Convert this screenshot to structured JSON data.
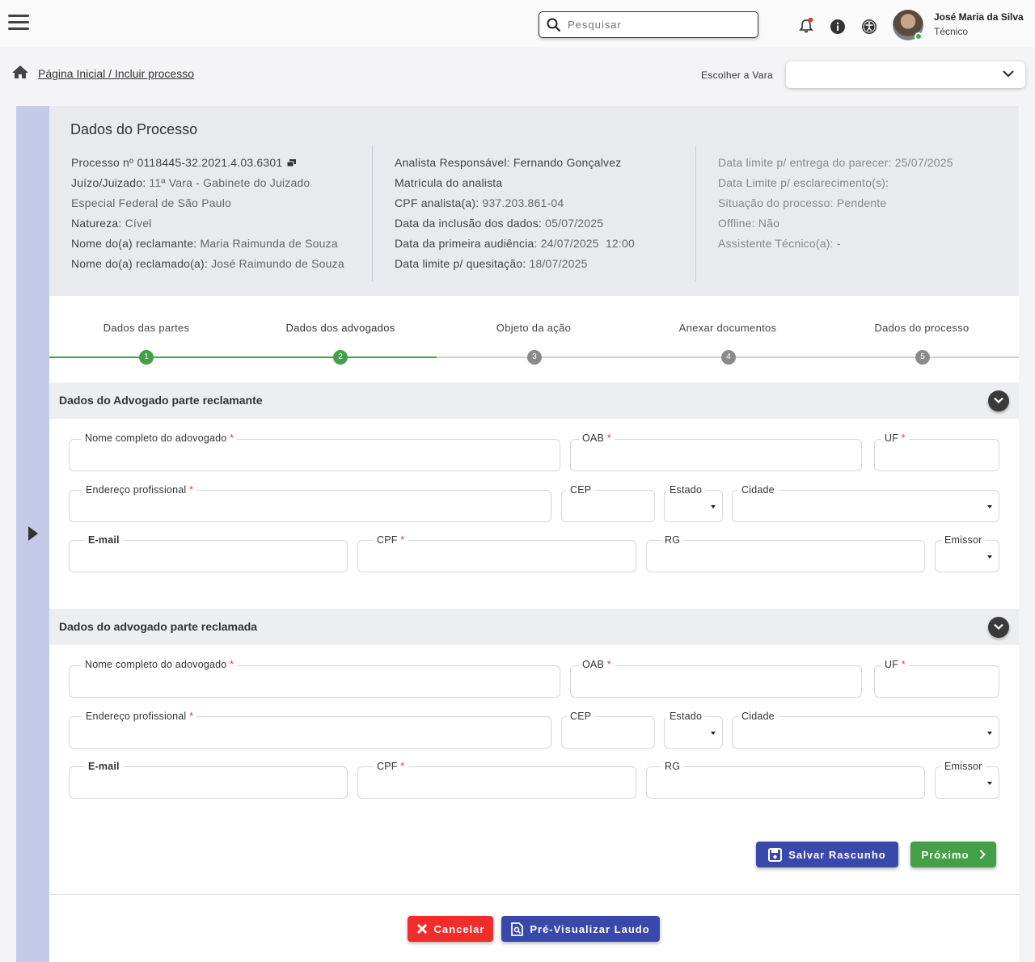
{
  "header": {
    "search_placeholder": "Pesquisar",
    "user_name": "José Maria da Silva",
    "user_role": "Técnico"
  },
  "breadcrumb": "Página Inicial / Incluir processo",
  "vara": {
    "label": "Escolher a Vara",
    "value": ""
  },
  "info": {
    "title": "Dados do Processo",
    "col1": [
      {
        "label": "Processo nº",
        "value": "0118445-32.2021.4.03.6301"
      },
      {
        "label": "Juízo/Juizado:",
        "value": "11ª Vara - Gabinete do Juizado"
      },
      {
        "label": "",
        "value": "Especial Federal de São Paulo"
      },
      {
        "label": "Natureza:",
        "value": "Cível"
      },
      {
        "label": "Nome do(a) reclamante:",
        "value": "Maria Raimunda de Souza"
      },
      {
        "label": "Nome do(a) reclamado(a):",
        "value": "José Raimundo de Souza"
      }
    ],
    "col2": [
      {
        "label": "Analista Responsável:",
        "value": "Fernando Gonçalvez"
      },
      {
        "label": "Matrícula do analista",
        "value": ""
      },
      {
        "label": "CPF analista(a):",
        "value": "937.203.861-04"
      },
      {
        "label": "Data da inclusão dos dados:",
        "value": "05/07/2025"
      },
      {
        "label": "Data da primeira audiência:",
        "value": "24/07/2025  12:00"
      },
      {
        "label": "Data limite p/ quesitação:",
        "value": "18/07/2025"
      }
    ],
    "col3": [
      {
        "label": "Data limite p/ entrega do parecer:",
        "value": "25/07/2025"
      },
      {
        "label": "Data Limite p/ esclarecimento(s):",
        "value": ""
      },
      {
        "label": "Situação do processo:",
        "value": "Pendente"
      },
      {
        "label": "Offline:",
        "value": "Não"
      },
      {
        "label": "Assistente Técnico(a):",
        "value": "-"
      }
    ]
  },
  "steps": [
    {
      "label": "Dados das partes",
      "number": "1",
      "status": "done"
    },
    {
      "label": "Dados dos advogados",
      "number": "2",
      "status": "current"
    },
    {
      "label": "Objeto da ação",
      "number": "3",
      "status": "pending"
    },
    {
      "label": "Anexar documentos",
      "number": "4",
      "status": "pending"
    },
    {
      "label": "Dados do processo",
      "number": "5",
      "status": "pending"
    }
  ],
  "sections": [
    {
      "title": "Dados do Advogado parte reclamante"
    },
    {
      "title": "Dados do advogado parte reclamada"
    }
  ],
  "fields": {
    "nome": "Nome completo do adovogado",
    "oab": "OAB",
    "uf": "UF",
    "endereco": "Endereço profissional",
    "cep": "CEP",
    "estado": "Estado",
    "cidade": "Cidade",
    "email": "E-mail",
    "cpf": "CPF",
    "rg": "RG",
    "emissor": "Emissor",
    "required_mark": "*"
  },
  "buttons": {
    "save_draft": "Salvar Rascunho",
    "next": "Próximo",
    "cancel": "Cancelar",
    "preview": "Pré-Visualizar Laudo"
  },
  "colors": {
    "primary": "#3949ab",
    "success": "#43a047",
    "danger": "#f22b2b",
    "rail": "#c5cae9",
    "step_pending": "#8a8a8a"
  }
}
